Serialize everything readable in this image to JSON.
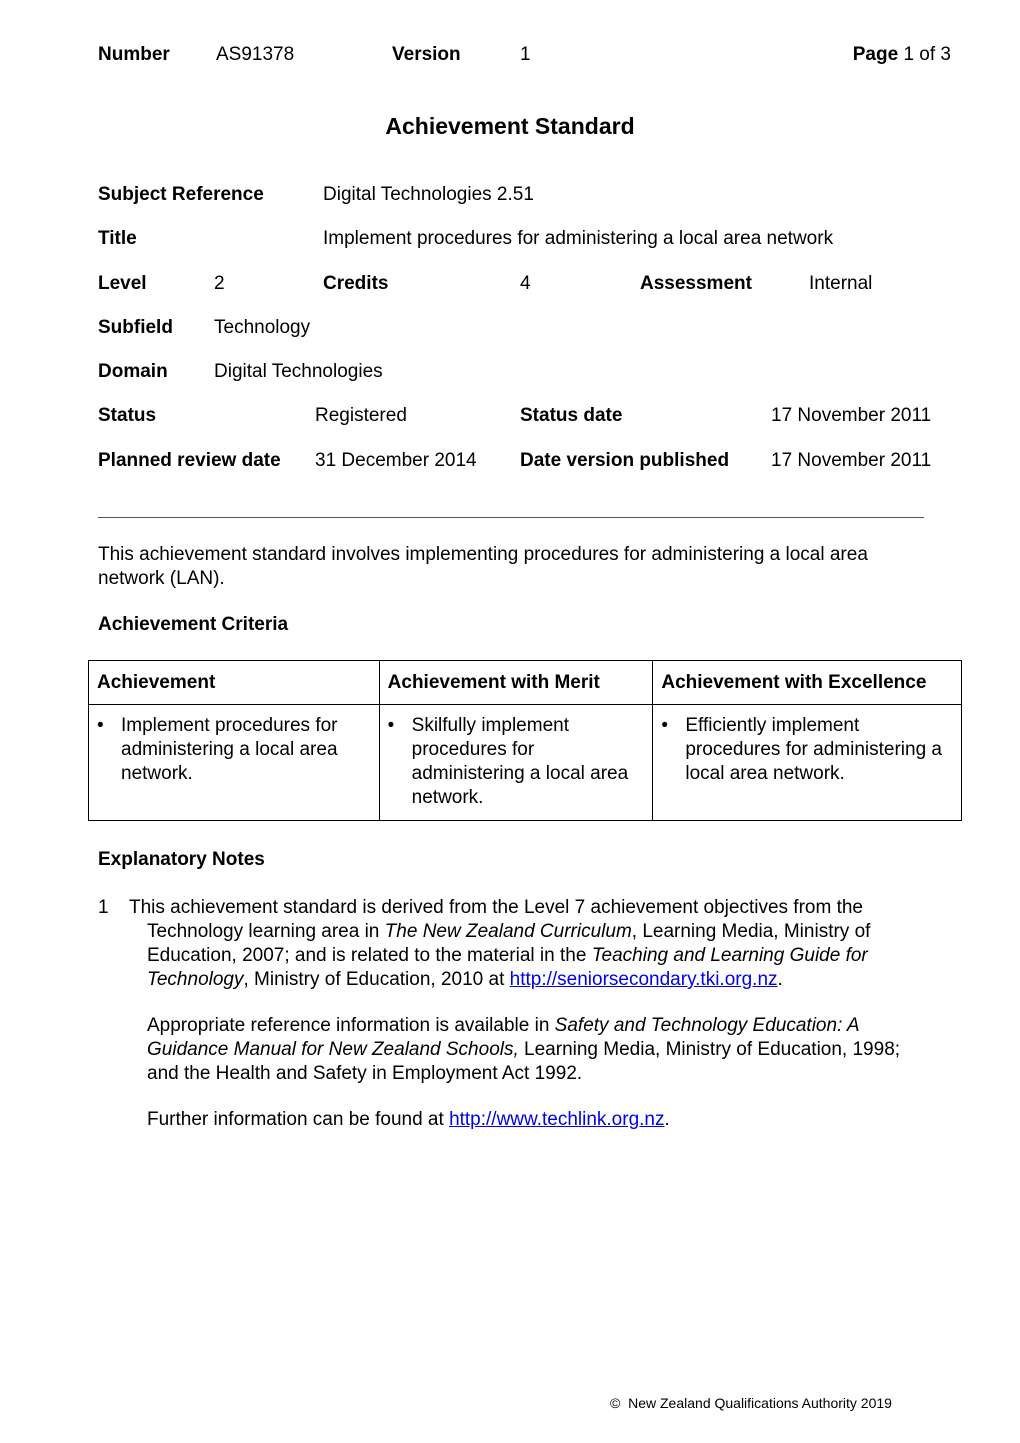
{
  "header": {
    "number_label": "Number",
    "number_value": "AS91378",
    "version_label": "Version",
    "version_value": "1",
    "page_label": "Page",
    "page_value": "1 of 3"
  },
  "document_title": "Achievement Standard",
  "fields": {
    "subject_reference_label": "Subject Reference",
    "subject_reference_value": "Digital Technologies 2.51",
    "title_label": "Title",
    "title_value": "Implement procedures for administering a local area network",
    "level_label": "Level",
    "level_value": "2",
    "credits_label": "Credits",
    "credits_value": "4",
    "assessment_label": "Assessment",
    "assessment_value": "Internal",
    "subfield_label": "Subfield",
    "subfield_value": "Technology",
    "domain_label": "Domain",
    "domain_value": "Digital Technologies",
    "status_label": "Status",
    "status_value": "Registered",
    "status_date_label": "Status date",
    "status_date_value": "17 November 2011",
    "planned_review_label": "Planned review date",
    "planned_review_value": "31 December 2014",
    "date_published_label": "Date version published",
    "date_published_value": "17 November 2011"
  },
  "intro": "This achievement standard involves implementing procedures for administering a local area network (LAN).",
  "criteria": {
    "heading": "Achievement Criteria",
    "columns": [
      "Achievement",
      "Achievement with Merit",
      "Achievement with Excellence"
    ],
    "cells": [
      "Implement procedures for administering a local area network.",
      "Skilfully implement procedures for administering a local area network.",
      "Efficiently implement procedures for administering a local area network."
    ],
    "bullet": "•"
  },
  "explanatory": {
    "heading": "Explanatory Notes",
    "note1": {
      "number": "1",
      "t1": "This achievement standard is derived from the Level 7 achievement objectives from the Technology learning area in ",
      "i1": "The New Zealand Curriculum",
      "t2": ", Learning Media, Ministry of Education, 2007; and is related to the material in the ",
      "i2": "Teaching and Learning Guide for Technology",
      "t3": ", Ministry of Education, 2010 at ",
      "link": "http://seniorsecondary.tki.org.nz",
      "t4": "."
    },
    "para2": {
      "t1": "Appropriate reference information is available in ",
      "i1": "Safety and Technology Education: A Guidance Manual for New Zealand Schools,",
      "t2": " Learning Media, Ministry of Education, 1998; and the Health and Safety in Employment Act 1992."
    },
    "para3": {
      "t1": "Further information can be found at ",
      "link": "http://www.techlink.org.nz",
      "t2": "."
    }
  },
  "footer": {
    "copyright_symbol": "©",
    "text": "New Zealand Qualifications Authority 2019"
  }
}
